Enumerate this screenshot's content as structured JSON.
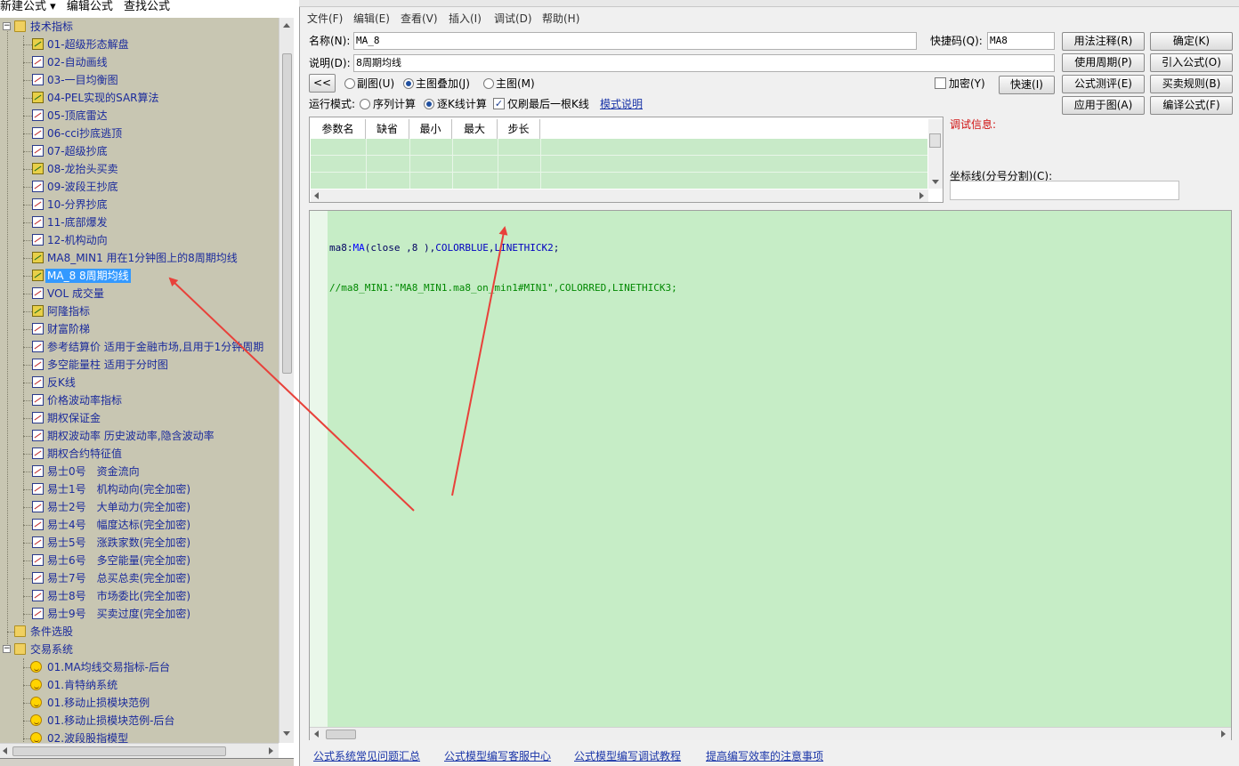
{
  "left_menu": [
    "新建公式 ▾",
    "编辑公式",
    "查找公式"
  ],
  "tree": {
    "folder_tech": "技术指标",
    "items": [
      {
        "label": "01-超级形态解盘",
        "icon": "color"
      },
      {
        "label": "02-自动画线",
        "icon": "formula"
      },
      {
        "label": "03-一目均衡图",
        "icon": "formula"
      },
      {
        "label": "04-PEL实现的SAR算法",
        "icon": "color"
      },
      {
        "label": "05-顶底雷达",
        "icon": "formula"
      },
      {
        "label": "06-cci抄底逃顶",
        "icon": "formula"
      },
      {
        "label": "07-超级抄底",
        "icon": "formula"
      },
      {
        "label": "08-龙抬头买卖",
        "icon": "color"
      },
      {
        "label": "09-波段王抄底",
        "icon": "formula"
      },
      {
        "label": "10-分界抄底",
        "icon": "formula"
      },
      {
        "label": "11-底部爆发",
        "icon": "formula"
      },
      {
        "label": "12-机构动向",
        "icon": "formula"
      },
      {
        "label": "MA8_MIN1 用在1分钟图上的8周期均线",
        "icon": "color"
      },
      {
        "label": "MA_8 8周期均线",
        "icon": "color",
        "selected": true
      },
      {
        "label": "VOL 成交量",
        "icon": "formula"
      },
      {
        "label": "阿隆指标",
        "icon": "color"
      },
      {
        "label": "财富阶梯",
        "icon": "formula"
      },
      {
        "label": "参考结算价 适用于金融市场,且用于1分钟周期",
        "icon": "formula"
      },
      {
        "label": "多空能量柱 适用于分时图",
        "icon": "formula"
      },
      {
        "label": "反K线",
        "icon": "formula"
      },
      {
        "label": "价格波动率指标",
        "icon": "formula"
      },
      {
        "label": "期权保证金",
        "icon": "formula"
      },
      {
        "label": "期权波动率 历史波动率,隐含波动率",
        "icon": "formula"
      },
      {
        "label": "期权合约特征值",
        "icon": "formula"
      },
      {
        "label": "易士0号　资金流向",
        "icon": "formula"
      },
      {
        "label": "易士1号　机构动向(完全加密)",
        "icon": "formula"
      },
      {
        "label": "易士2号　大单动力(完全加密)",
        "icon": "formula"
      },
      {
        "label": "易士4号　幅度达标(完全加密)",
        "icon": "formula"
      },
      {
        "label": "易士5号　涨跌家数(完全加密)",
        "icon": "formula"
      },
      {
        "label": "易士6号　多空能量(完全加密)",
        "icon": "formula"
      },
      {
        "label": "易士7号　总买总卖(完全加密)",
        "icon": "formula"
      },
      {
        "label": "易士8号　市场委比(完全加密)",
        "icon": "formula"
      },
      {
        "label": "易士9号　买卖过度(完全加密)",
        "icon": "formula"
      }
    ],
    "folder_cond": "条件选股",
    "folder_trade": "交易系统",
    "trade_items": [
      {
        "label": "01.MA均线交易指标-后台"
      },
      {
        "label": "01.肯特纳系统"
      },
      {
        "label": "01.移动止损模块范例"
      },
      {
        "label": "01.移动止损模块范例-后台"
      },
      {
        "label": "02.波段股指模型"
      }
    ]
  },
  "menubar": [
    "文件(F)",
    "编辑(E)",
    "查看(V)",
    "插入(I)",
    "调试(D)",
    "帮助(H)"
  ],
  "form": {
    "name_label": "名称(N):",
    "name_value": "MA_8",
    "shortcut_label": "快捷码(Q):",
    "shortcut_value": "MA8",
    "desc_label": "说明(D):",
    "desc_value": "8周期均线",
    "back_btn": "<<",
    "radio_sub": "副图(U)",
    "radio_overlay": "主图叠加(J)",
    "radio_main": "主图(M)",
    "encrypt_label": "加密(Y)",
    "quick_btn": "快速(I)",
    "run_label": "运行模式:",
    "radio_seq": "序列计算",
    "radio_kline": "逐K线计算",
    "last_only_label": "仅刷最后一根K线",
    "mode_help_link": "模式说明",
    "buttons": [
      "用法注释(R)",
      "确定(K)",
      "使用周期(P)",
      "引入公式(O)",
      "公式测评(E)",
      "买卖规则(B)",
      "应用于图(A)",
      "编译公式(F)"
    ]
  },
  "params": {
    "headers": [
      "参数名",
      "缺省",
      "最小",
      "最大",
      "步长"
    ]
  },
  "debug_label": "调试信息:",
  "coord_label": "坐标线(分号分割)(C):",
  "code": {
    "line1": {
      "var": "ma8:",
      "fn": "MA",
      "args": "(close ,8 ),",
      "color": "COLORBLUE",
      "sep": ",",
      "thick": "LINETHICK2",
      "end": ";"
    },
    "line2": "//ma8_MIN1:\"MA8_MIN1.ma8_on_min1#MIN1\",COLORRED,LINETHICK3;"
  },
  "bottom_links": [
    "公式系统常见问题汇总",
    "公式模型编写客服中心",
    "公式模型编写调试教程",
    "提高编写效率的注意事项"
  ],
  "colors": {
    "tree_bg": "#c8c6b2",
    "editor_bg": "#c6edc6",
    "grid_bg": "#c8eac8",
    "arrow": "#e8413a",
    "selection": "#3399ff",
    "link": "#1a35a8"
  }
}
